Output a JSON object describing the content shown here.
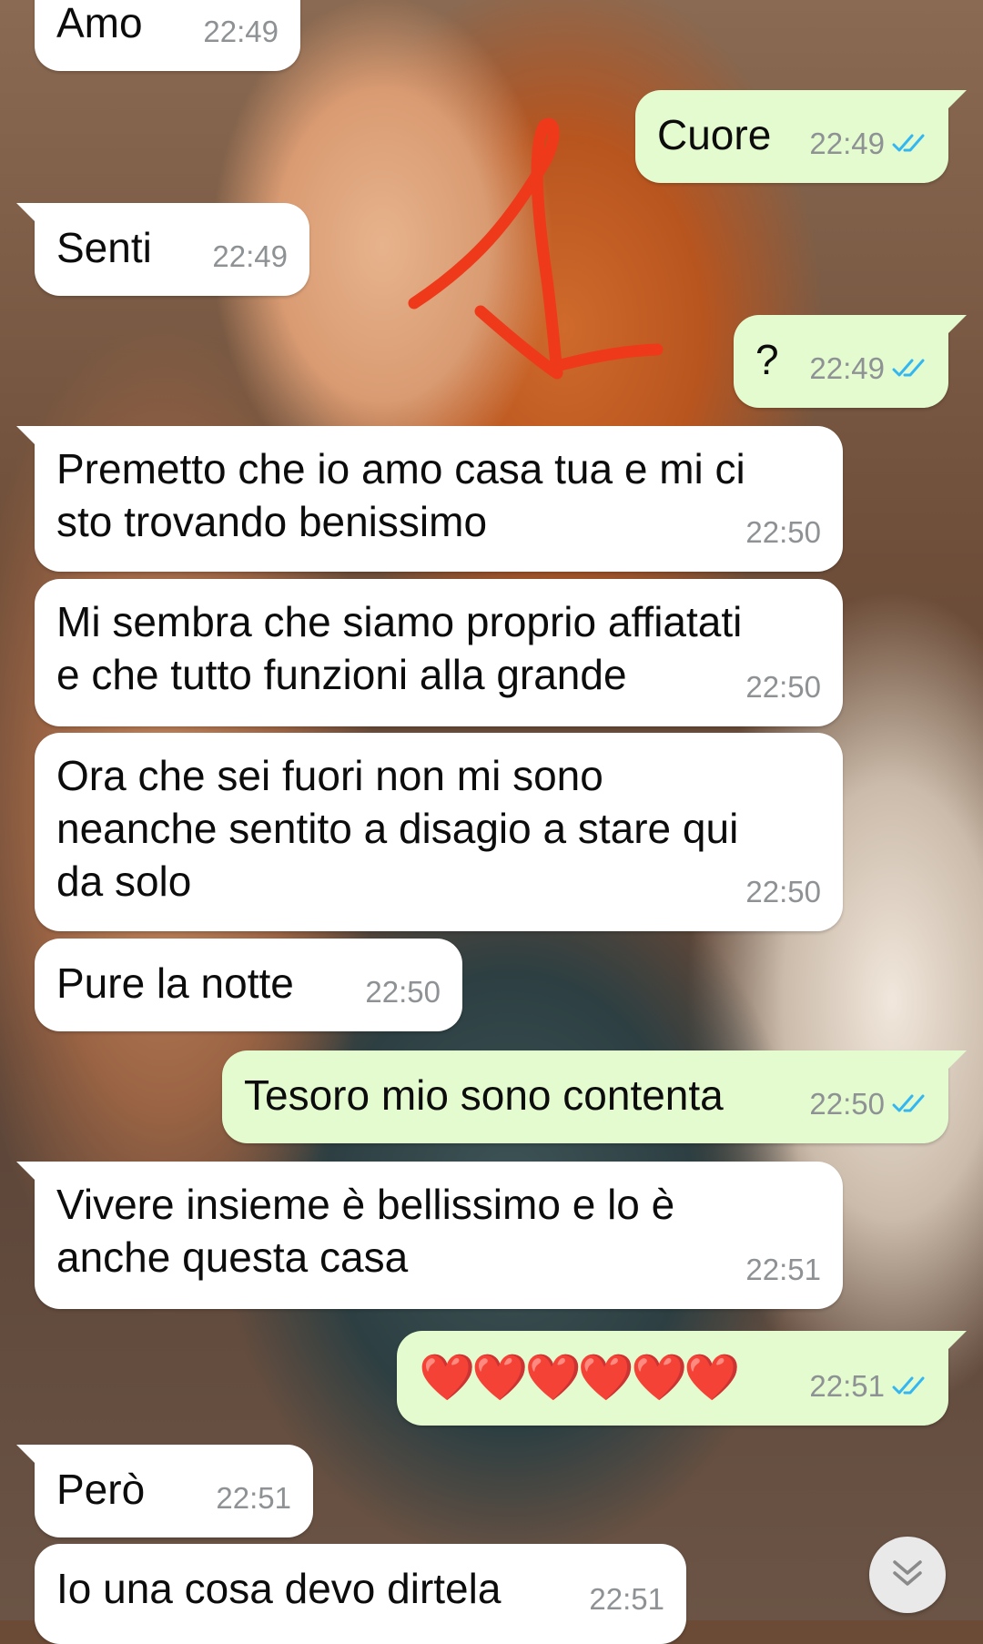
{
  "chat": {
    "messages": [
      {
        "direction": "in",
        "text": "Amo",
        "time": "22:49"
      },
      {
        "direction": "out",
        "text": "Cuore",
        "time": "22:49",
        "status": "read"
      },
      {
        "direction": "in",
        "text": "Senti",
        "time": "22:49"
      },
      {
        "direction": "out",
        "text": "?",
        "time": "22:49",
        "status": "read"
      },
      {
        "direction": "in",
        "lines": [
          "Premetto che io amo casa tua e mi ci",
          "sto trovando benissimo"
        ],
        "time": "22:50"
      },
      {
        "direction": "in",
        "lines": [
          "Mi sembra che siamo proprio affiatati",
          "e che tutto funzioni alla grande"
        ],
        "time": "22:50"
      },
      {
        "direction": "in",
        "lines": [
          "Ora che sei fuori non mi sono",
          "neanche sentito a disagio a stare qui",
          "da solo"
        ],
        "time": "22:50"
      },
      {
        "direction": "in",
        "text": "Pure la notte",
        "time": "22:50"
      },
      {
        "direction": "out",
        "text": "Tesoro mio sono contenta",
        "time": "22:50",
        "status": "read"
      },
      {
        "direction": "in",
        "lines": [
          "Vivere insieme è bellissimo e lo è",
          "anche questa casa"
        ],
        "time": "22:51"
      },
      {
        "direction": "out",
        "text": "❤️❤️❤️❤️❤️❤️",
        "time": "22:51",
        "status": "read"
      },
      {
        "direction": "in",
        "text": "Però",
        "time": "22:51"
      },
      {
        "direction": "in",
        "text": "Io una cosa devo dirtela",
        "time": "22:51"
      }
    ]
  },
  "colors": {
    "incoming_bubble": "#ffffff",
    "outgoing_bubble": "#e4fbd0",
    "read_ticks": "#34b7f1",
    "timestamp": "#8e9294",
    "annotation": "#ee3a1a"
  },
  "icons": {
    "read_status": "double-check-icon",
    "scroll_down": "double-chevron-down-icon"
  }
}
